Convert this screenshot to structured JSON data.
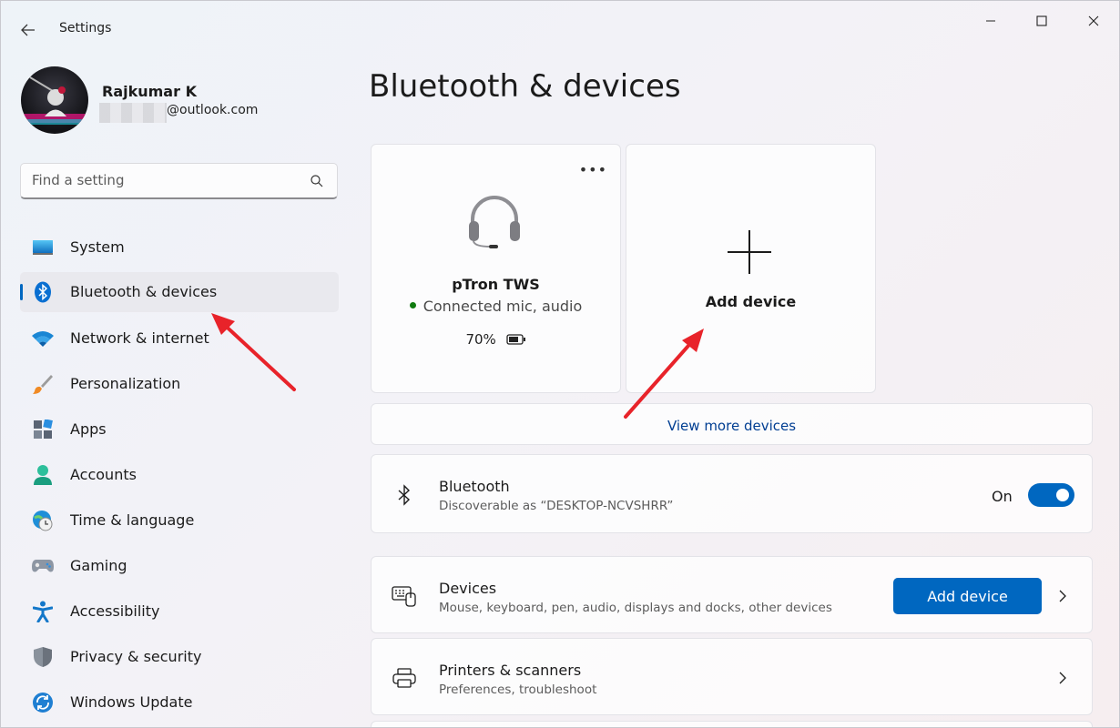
{
  "window": {
    "title": "Settings",
    "accent_color": "#0067c0"
  },
  "profile": {
    "name": "Rajkumar K",
    "email_suffix": "@outlook.com"
  },
  "search": {
    "placeholder": "Find a setting"
  },
  "sidebar": {
    "items": [
      {
        "label": "System",
        "icon": "monitor-icon",
        "active": false
      },
      {
        "label": "Bluetooth & devices",
        "icon": "bluetooth-icon",
        "active": true
      },
      {
        "label": "Network & internet",
        "icon": "wifi-icon",
        "active": false
      },
      {
        "label": "Personalization",
        "icon": "paintbrush-icon",
        "active": false
      },
      {
        "label": "Apps",
        "icon": "apps-icon",
        "active": false
      },
      {
        "label": "Accounts",
        "icon": "person-icon",
        "active": false
      },
      {
        "label": "Time & language",
        "icon": "globe-clock-icon",
        "active": false
      },
      {
        "label": "Gaming",
        "icon": "gamepad-icon",
        "active": false
      },
      {
        "label": "Accessibility",
        "icon": "accessibility-icon",
        "active": false
      },
      {
        "label": "Privacy & security",
        "icon": "shield-icon",
        "active": false
      },
      {
        "label": "Windows Update",
        "icon": "update-icon",
        "active": false
      }
    ]
  },
  "main": {
    "title": "Bluetooth & devices",
    "device": {
      "name": "pTron TWS",
      "status": "Connected mic, audio",
      "battery": "70%",
      "icon": "headset-icon"
    },
    "add_device_card": {
      "label": "Add device"
    },
    "view_more": "View more devices",
    "bluetooth": {
      "title": "Bluetooth",
      "subtitle": "Discoverable as “DESKTOP-NCVSHRR”",
      "toggle_label": "On",
      "toggle_on": true
    },
    "devices": {
      "title": "Devices",
      "subtitle": "Mouse, keyboard, pen, audio, displays and docks, other devices",
      "button": "Add device"
    },
    "printers": {
      "title": "Printers & scanners",
      "subtitle": "Preferences, troubleshoot"
    }
  },
  "annotations": {
    "arrow_color": "#e8232a"
  }
}
